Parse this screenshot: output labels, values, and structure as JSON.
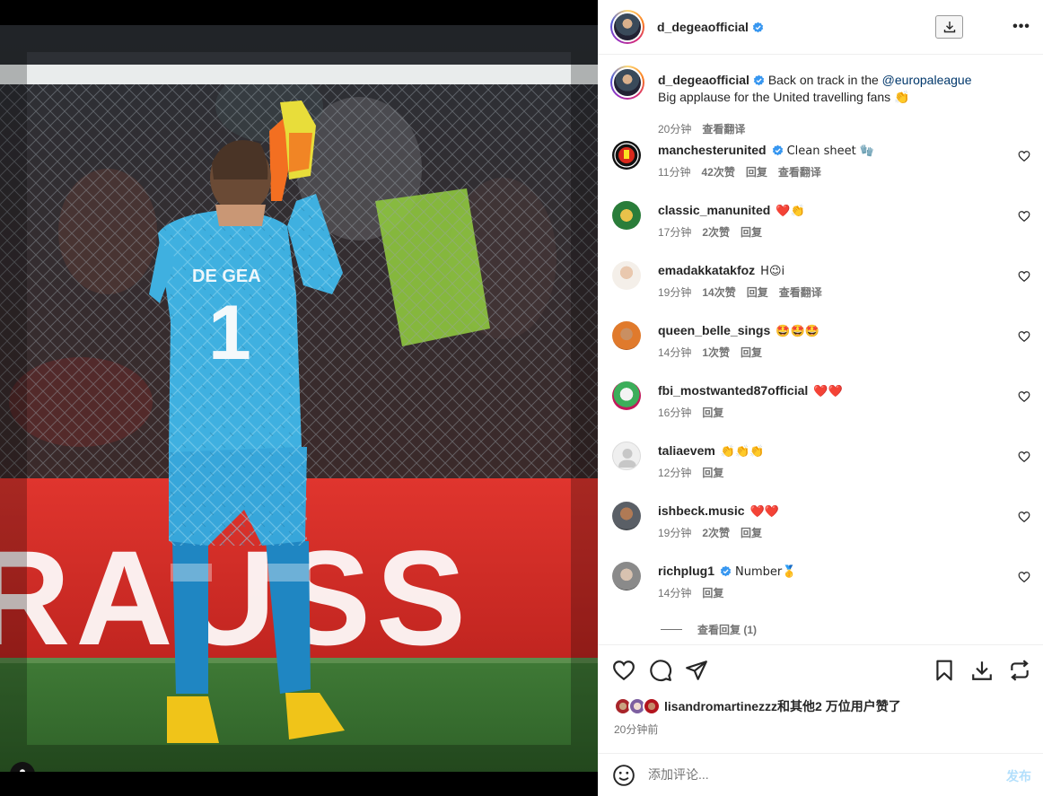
{
  "post": {
    "username": "d_degeaofficial",
    "verified": true,
    "caption": {
      "username": "d_degeaofficial",
      "text_before": "Back on track in the ",
      "mention": "@europaleague",
      "line2": "Big applause for the United travelling fans 👏",
      "time": "20分钟",
      "translate": "查看翻译"
    },
    "photo": {
      "player_name": "DE GEA",
      "player_number": "1"
    },
    "comments": [
      {
        "username": "manchesterunited",
        "verified": true,
        "text": "Clean sheet 🧤",
        "time": "11分钟",
        "likes": "42次赞",
        "reply": "回复",
        "translate": "查看翻译"
      },
      {
        "username": "classic_manunited",
        "verified": false,
        "text": "❤️👏",
        "time": "17分钟",
        "likes": "2次赞",
        "reply": "回复"
      },
      {
        "username": "emadakkatakfoz",
        "verified": false,
        "text": "H😉i",
        "time": "19分钟",
        "likes": "14次赞",
        "reply": "回复",
        "translate": "查看翻译"
      },
      {
        "username": "queen_belle_sings",
        "verified": false,
        "text": "🤩🤩🤩",
        "time": "14分钟",
        "likes": "1次赞",
        "reply": "回复"
      },
      {
        "username": "fbi_mostwanted87official",
        "verified": false,
        "text": "❤️❤️",
        "time": "16分钟",
        "reply": "回复"
      },
      {
        "username": "taliaevem",
        "verified": false,
        "text": "👏👏👏",
        "time": "12分钟",
        "reply": "回复"
      },
      {
        "username": "ishbeck.music",
        "verified": false,
        "text": "❤️❤️",
        "time": "19分钟",
        "likes": "2次赞",
        "reply": "回复"
      },
      {
        "username": "richplug1",
        "verified": true,
        "text": "Number🥇",
        "time": "14分钟",
        "reply": "回复"
      }
    ],
    "view_replies": "查看回复 (1)",
    "likes_text": "lisandromartinezzz和其他2 万位用户赞了",
    "posted_time": "20分钟前",
    "add_comment_placeholder": "添加评论...",
    "post_button": "发布"
  },
  "colors": {
    "verified_blue": "#3897f0",
    "link": "#00376b",
    "secondary_text": "#737373",
    "post_button_disabled": "#b2dffc"
  },
  "icons": [
    "user-tag-icon",
    "download-icon",
    "more-icon",
    "heart-icon",
    "comment-icon",
    "share-icon",
    "bookmark-icon",
    "download-action-icon",
    "repost-icon",
    "emoji-icon",
    "verified-badge-icon"
  ]
}
